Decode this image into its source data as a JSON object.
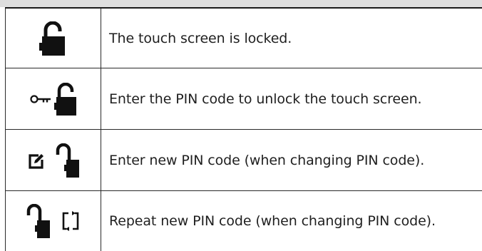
{
  "rows": [
    {
      "icons": [
        "padlock-open-icon"
      ],
      "text": "The touch screen is locked."
    },
    {
      "icons": [
        "key-icon",
        "padlock-open-icon"
      ],
      "text": "Enter the PIN code to unlock the touch screen."
    },
    {
      "icons": [
        "edit-icon",
        "padlock-open-icon"
      ],
      "text": "Enter new PIN code (when changing PIN code)."
    },
    {
      "icons": [
        "padlock-open-icon",
        "repeat-icon"
      ],
      "text": "Repeat new PIN code (when changing PIN code)."
    }
  ]
}
